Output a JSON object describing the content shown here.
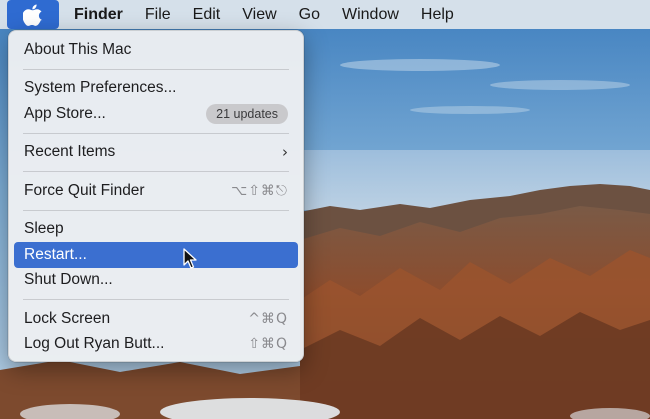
{
  "menubar": {
    "apple_icon": "apple-logo-icon",
    "items": [
      {
        "label": "Finder"
      },
      {
        "label": "File"
      },
      {
        "label": "Edit"
      },
      {
        "label": "View"
      },
      {
        "label": "Go"
      },
      {
        "label": "Window"
      },
      {
        "label": "Help"
      }
    ]
  },
  "apple_menu": {
    "about": {
      "label": "About This Mac"
    },
    "system_preferences": {
      "label": "System Preferences..."
    },
    "app_store": {
      "label": "App Store...",
      "badge": "21 updates"
    },
    "recent_items": {
      "label": "Recent Items",
      "submenu_icon": "chevron-right-icon"
    },
    "force_quit": {
      "label": "Force Quit Finder",
      "shortcut": "⌥⇧⌘⎋"
    },
    "sleep": {
      "label": "Sleep"
    },
    "restart": {
      "label": "Restart...",
      "highlighted": true
    },
    "shut_down": {
      "label": "Shut Down..."
    },
    "lock_screen": {
      "label": "Lock Screen",
      "shortcut": "^⌘Q"
    },
    "log_out": {
      "label": "Log Out Ryan Butt...",
      "shortcut": "⇧⌘Q"
    }
  },
  "colors": {
    "highlight": "#3b6fd0",
    "apple_item_bg": "#2f6bd1",
    "sky": "#6f9fce"
  }
}
